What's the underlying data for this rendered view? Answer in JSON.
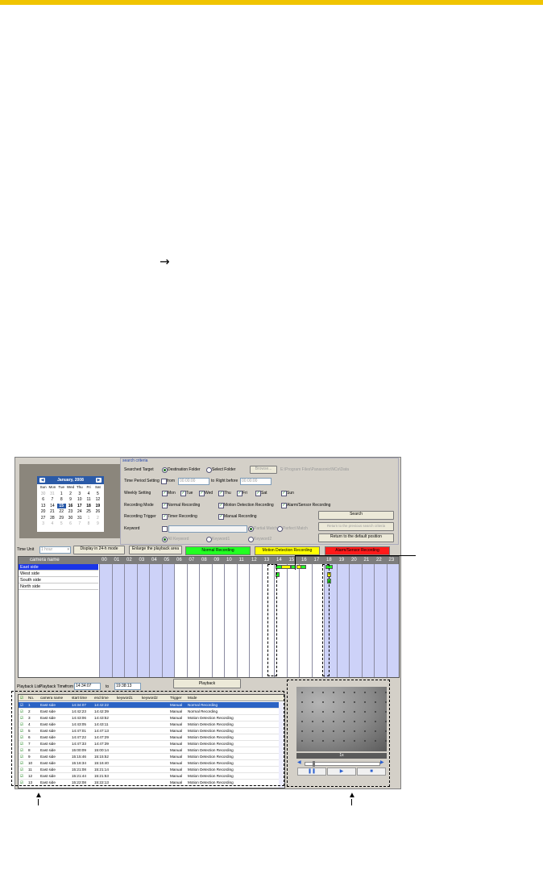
{
  "arrow_glyph": "→",
  "calendar": {
    "month": "January, 2008",
    "prev_icon": "chevron-left-icon",
    "next_icon": "chevron-right-icon",
    "weekdays": [
      "Sun",
      "Mon",
      "Tue",
      "Wed",
      "Thu",
      "Fri",
      "Sat"
    ],
    "days": [
      "30",
      "31",
      "1",
      "2",
      "3",
      "4",
      "5",
      "6",
      "7",
      "8",
      "9",
      "10",
      "11",
      "12",
      "13",
      "14",
      "15",
      "16",
      "17",
      "18",
      "19",
      "20",
      "21",
      "22",
      "23",
      "24",
      "25",
      "26",
      "27",
      "28",
      "29",
      "30",
      "31",
      "1",
      "2",
      "3",
      "4",
      "5",
      "6",
      "7",
      "8",
      "9"
    ],
    "selected_day": "15"
  },
  "criteria": {
    "title": "search criteria",
    "searched_target_label": "Searched Target",
    "destination_folder": "Destination Folder",
    "select_folder": "Select Folder",
    "browse": "Browse...",
    "folder_path": "E:\\Program Files\\Panasonic\\NCs\\Data",
    "time_period_label": "Time Period Setting",
    "from": "from",
    "from_time": "00:00:00",
    "to_label": "to",
    "right_before": "Right before",
    "to_time": "00:00:00",
    "weekly_label": "Weekly Setting",
    "days": [
      "Mon",
      "Tue",
      "Wed",
      "Thu",
      "Fri",
      "Sat",
      "Sun"
    ],
    "recording_mode_label": "Recording Mode",
    "modes": [
      "Normal Recording",
      "Motion Detection Recording",
      "Alarm/Sensor Recording"
    ],
    "recording_trigger_label": "Recording Trigger",
    "triggers": [
      "Timer Recording",
      "Manual Recording"
    ],
    "keyword_label": "Keyword",
    "partial_match": "Partial Match",
    "perfect_match": "Perfect Match",
    "all_keyword": "All Keyword",
    "keyword1": "Keyword1",
    "keyword2": "Keyword2",
    "search": "Search",
    "return_prev": "Return to the previous search criteria",
    "return_default": "Return to the default position"
  },
  "toolbar": {
    "time_unit_label": "Time Unit",
    "time_unit_value": "1 hour",
    "display_24h": "Display in 24-h mode",
    "enlarge": "Enlarge the playback area"
  },
  "legend": {
    "normal": "Normal Recording",
    "motion": "Motion Detection Recording",
    "alarm": "Alarm/Sensor Recording",
    "normal_color": "#22ff22",
    "motion_color": "#ffff00",
    "alarm_color": "#ff1a1a"
  },
  "timeline": {
    "header": "camera name",
    "hours": [
      "00",
      "01",
      "02",
      "03",
      "04",
      "05",
      "06",
      "07",
      "08",
      "09",
      "10",
      "11",
      "12",
      "13",
      "14",
      "15",
      "16",
      "17",
      "18",
      "19",
      "20",
      "21",
      "22",
      "23"
    ],
    "cameras": [
      "East side",
      "West side",
      "South side",
      "North side"
    ],
    "selected_camera": "East side",
    "selection_color": "#1a35e8",
    "shade_color": "#cdd2f8"
  },
  "playback": {
    "list_label": "Playback List",
    "time_label": "Playback Time",
    "from": "from",
    "from_time": "14:34:07",
    "to": "to",
    "to_time": "19:38:13",
    "button": "Playback"
  },
  "list": {
    "columns": [
      "No.",
      "camera name",
      "start time",
      "end time",
      "keyword1",
      "keyword2",
      "Trigger",
      "Mode"
    ],
    "rows": [
      [
        "1",
        "East side",
        "14:34:07",
        "14:42:22",
        "",
        "",
        "Manual",
        "Normal Recording"
      ],
      [
        "2",
        "East side",
        "14:42:23",
        "14:42:39",
        "",
        "",
        "Manual",
        "Normal Recording"
      ],
      [
        "3",
        "East side",
        "14:43:06",
        "14:43:52",
        "",
        "",
        "Manual",
        "Motion Detection Recording"
      ],
      [
        "4",
        "East side",
        "14:43:05",
        "14:43:11",
        "",
        "",
        "Manual",
        "Motion Detection Recording"
      ],
      [
        "5",
        "East side",
        "14:47:01",
        "14:47:13",
        "",
        "",
        "Manual",
        "Motion Detection Recording"
      ],
      [
        "6",
        "East side",
        "14:47:22",
        "14:47:29",
        "",
        "",
        "Manual",
        "Motion Detection Recording"
      ],
      [
        "7",
        "East side",
        "14:47:33",
        "14:47:39",
        "",
        "",
        "Manual",
        "Motion Detection Recording"
      ],
      [
        "8",
        "East side",
        "15:00:09",
        "15:00:14",
        "",
        "",
        "Manual",
        "Motion Detection Recording"
      ],
      [
        "9",
        "East side",
        "15:15:46",
        "15:15:52",
        "",
        "",
        "Manual",
        "Motion Detection Recording"
      ],
      [
        "10",
        "East side",
        "15:16:34",
        "15:16:40",
        "",
        "",
        "Manual",
        "Motion Detection Recording"
      ],
      [
        "11",
        "East side",
        "15:21:08",
        "15:21:14",
        "",
        "",
        "Manual",
        "Motion Detection Recording"
      ],
      [
        "12",
        "East side",
        "15:21:44",
        "15:21:53",
        "",
        "",
        "Manual",
        "Motion Detection Recording"
      ],
      [
        "13",
        "East side",
        "15:22:08",
        "15:22:13",
        "",
        "",
        "Manual",
        "Motion Detection Recording"
      ]
    ]
  },
  "viewer": {
    "speed": "1x",
    "pause_icon": "pause-icon",
    "play_icon": "play-icon",
    "stop_icon": "stop-icon",
    "prev_icon": "skip-back-icon",
    "next_icon": "skip-forward-icon",
    "playback_position": 0.1,
    "button_color": "#2a5fd0"
  }
}
